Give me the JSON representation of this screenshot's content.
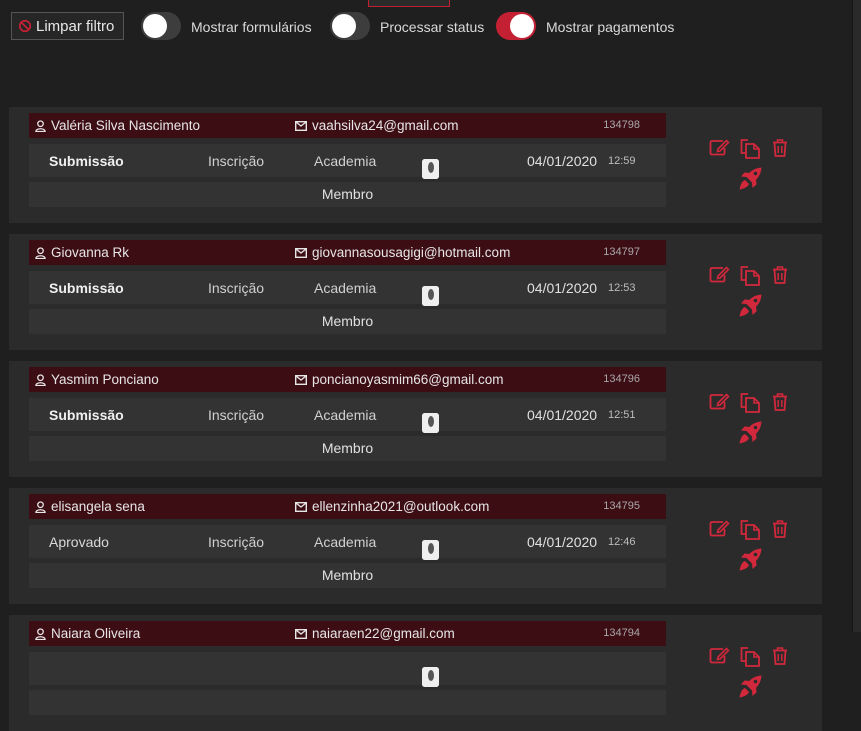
{
  "filters": {
    "clear_label": "Limpar filtro",
    "toggles": [
      {
        "label": "Mostrar formulários",
        "on": false
      },
      {
        "label": "Processar status",
        "on": false
      },
      {
        "label": "Mostrar pagamentos",
        "on": true
      }
    ]
  },
  "colors": {
    "accent": "#c42033",
    "header_bg": "#3d0d14",
    "card_bg": "#2b2b2b"
  },
  "entries": [
    {
      "name": "Valéria Silva Nascimento",
      "email": "vaahsilva24@gmail.com",
      "id": "134798",
      "status": "Submissão",
      "type": "Inscrição",
      "category": "Academia",
      "date": "04/01/2020",
      "time": "12:59",
      "role": "Membro"
    },
    {
      "name": "Giovanna Rk",
      "email": "giovannasousagigi@hotmail.com",
      "id": "134797",
      "status": "Submissão",
      "type": "Inscrição",
      "category": "Academia",
      "date": "04/01/2020",
      "time": "12:53",
      "role": "Membro"
    },
    {
      "name": "Yasmim Ponciano",
      "email": "poncianoyasmim66@gmail.com",
      "id": "134796",
      "status": "Submissão",
      "type": "Inscrição",
      "category": "Academia",
      "date": "04/01/2020",
      "time": "12:51",
      "role": "Membro"
    },
    {
      "name": "elisangela sena",
      "email": "ellenzinha2021@outlook.com",
      "id": "134795",
      "status": "Aprovado",
      "type": "Inscrição",
      "category": "Academia",
      "date": "04/01/2020",
      "time": "12:46",
      "role": "Membro"
    },
    {
      "name": "Naiara Oliveira",
      "email": "naiaraen22@gmail.com",
      "id": "134794",
      "status": "",
      "type": "",
      "category": "",
      "date": "",
      "time": "",
      "role": ""
    }
  ],
  "icons": [
    "user-icon",
    "envelope-icon",
    "edit-icon",
    "copy-icon",
    "trash-icon",
    "rocket-icon",
    "ban-icon"
  ]
}
